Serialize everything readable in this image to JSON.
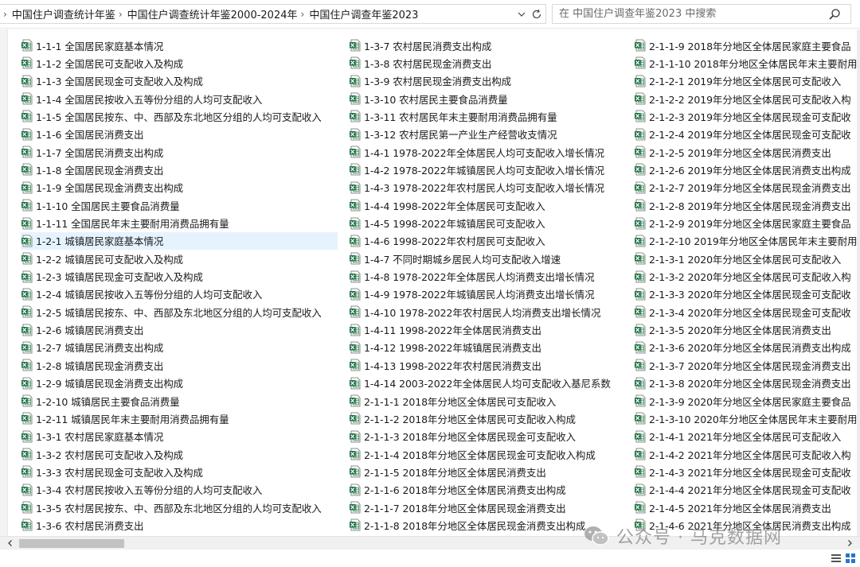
{
  "breadcrumb": {
    "separator": "›",
    "items": [
      "中国住户调查统计年鉴",
      "中国住户调查统计年鉴2000-2024年",
      "中国住户调查年鉴2023"
    ]
  },
  "search": {
    "placeholder": "在 中国住户调查年鉴2023 中搜索"
  },
  "icons": {
    "file": "spreadsheet-file-icon",
    "dropdown": "chevron-down-icon",
    "refresh": "refresh-icon",
    "search": "search-icon"
  },
  "colors": {
    "excel_green": "#1e7145",
    "selection": "#e5f3ff"
  },
  "selected_file": "1-2-1 城镇居民家庭基本情况",
  "files": {
    "col1": [
      "1-1-1 全国居民家庭基本情况",
      "1-1-2 全国居民可支配收入及构成",
      "1-1-3 全国居民现金可支配收入及构成",
      "1-1-4 全国居民按收入五等份分组的人均可支配收入",
      "1-1-5 全国居民按东、中、西部及东北地区分组的人均可支配收入",
      "1-1-6 全国居民消费支出",
      "1-1-7 全国居民消费支出构成",
      "1-1-8 全国居民现金消费支出",
      "1-1-9 全国居民现金消费支出构成",
      "1-1-10 全国居民主要食品消费量",
      "1-1-11 全国居民年末主要耐用消费品拥有量",
      "1-2-1 城镇居民家庭基本情况",
      "1-2-2 城镇居民可支配收入及构成",
      "1-2-3 城镇居民现金可支配收入及构成",
      "1-2-4 城镇居民按收入五等份分组的人均可支配收入",
      "1-2-5 城镇居民按东、中、西部及东北地区分组的人均可支配收入",
      "1-2-6 城镇居民消费支出",
      "1-2-7 城镇居民消费支出构成",
      "1-2-8 城镇居民现金消费支出",
      "1-2-9 城镇居民现金消费支出构成",
      "1-2-10 城镇居民主要食品消费量",
      "1-2-11 城镇居民年末主要耐用消费品拥有量",
      "1-3-1 农村居民家庭基本情况",
      "1-3-2 农村居民可支配收入及构成",
      "1-3-3 农村居民现金可支配收入及构成",
      "1-3-4 农村居民按收入五等份分组的人均可支配收入",
      "1-3-5 农村居民按东、中、西部及东北地区分组的人均可支配收入",
      "1-3-6 农村居民消费支出"
    ],
    "col2": [
      "1-3-7 农村居民消费支出构成",
      "1-3-8 农村居民现金消费支出",
      "1-3-9 农村居民现金消费支出构成",
      "1-3-10 农村居民主要食品消费量",
      "1-3-11 农村居民年末主要耐用消费品拥有量",
      "1-3-12 农村居民第一产业生产经营收支情况",
      "1-4-1 1978-2022年全体居民人均可支配收入增长情况",
      "1-4-2 1978-2022年城镇居民人均可支配收入增长情况",
      "1-4-3 1978-2022年农村居民人均可支配收入增长情况",
      "1-4-4 1998-2022年全体居民可支配收入",
      "1-4-5 1998-2022年城镇居民可支配收入",
      "1-4-6 1998-2022年农村居民可支配收入",
      "1-4-7 不同时期城乡居民人均可支配收入增速",
      "1-4-8 1978-2022年全体居民人均消费支出增长情况",
      "1-4-9 1978-2022年城镇居民人均消费支出增长情况",
      "1-4-10 1978-2022年农村居民人均消费支出增长情况",
      "1-4-11 1998-2022年全体居民消费支出",
      "1-4-12 1998-2022年城镇居民消费支出",
      "1-4-13 1998-2022年农村居民消费支出",
      "1-4-14 2003-2022年全体居民人均可支配收入基尼系数",
      "2-1-1-1 2018年分地区全体居民可支配收入",
      "2-1-1-2 2018年分地区全体居民可支配收入构成",
      "2-1-1-3 2018年分地区全体居民现金可支配收入",
      "2-1-1-4 2018年分地区全体居民现金可支配收入构成",
      "2-1-1-5 2018年分地区全体居民消费支出",
      "2-1-1-6 2018年分地区全体居民消费支出构成",
      "2-1-1-7 2018年分地区全体居民现金消费支出",
      "2-1-1-8 2018年分地区全体居民现金消费支出构成"
    ],
    "col3": [
      "2-1-1-9 2018年分地区全体居民家庭主要食品",
      "2-1-1-10 2018年分地区全体居民年末主要耐用",
      "2-1-2-1 2019年分地区全体居民可支配收入",
      "2-1-2-2 2019年分地区全体居民可支配收入构",
      "2-1-2-3 2019年分地区全体居民现金可支配收",
      "2-1-2-4 2019年分地区全体居民现金可支配收",
      "2-1-2-5 2019年分地区全体居民消费支出",
      "2-1-2-6 2019年分地区全体居民消费支出构成",
      "2-1-2-7 2019年分地区全体居民现金消费支出",
      "2-1-2-8 2019年分地区全体居民现金消费支出",
      "2-1-2-9 2019年分地区全体居民家庭主要食品",
      "2-1-2-10 2019年分地区全体居民年末主要耐用",
      "2-1-3-1 2020年分地区全体居民可支配收入",
      "2-1-3-2 2020年分地区全体居民可支配收入构",
      "2-1-3-3 2020年分地区全体居民现金可支配收",
      "2-1-3-4 2020年分地区全体居民现金可支配收",
      "2-1-3-5 2020年分地区全体居民消费支出",
      "2-1-3-6 2020年分地区全体居民消费支出构成",
      "2-1-3-7 2020年分地区全体居民现金消费支出",
      "2-1-3-8 2020年分地区全体居民现金消费支出",
      "2-1-3-9 2020年分地区全体居民家庭主要食品",
      "2-1-3-10 2020年分地区全体居民年末主要耐用",
      "2-1-4-1 2021年分地区全体居民可支配收入",
      "2-1-4-2 2021年分地区全体居民可支配收入构",
      "2-1-4-3 2021年分地区全体居民现金可支配收",
      "2-1-4-4 2021年分地区全体居民现金可支配收",
      "2-1-4-5 2021年分地区全体居民消费支出",
      "2-1-4-6 2021年分地区全体居民消费支出构成"
    ]
  },
  "watermark": {
    "text": "公众号 · 马克数据网"
  }
}
